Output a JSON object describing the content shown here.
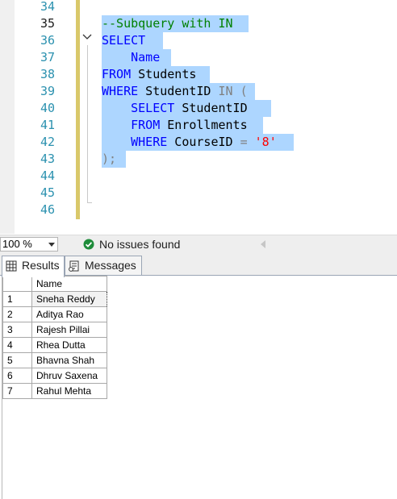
{
  "editor": {
    "line_numbers": [
      "34",
      "35",
      "36",
      "37",
      "38",
      "39",
      "40",
      "41",
      "42",
      "43",
      "44",
      "45",
      "46"
    ],
    "lines": {
      "l35": {
        "comment": "--Subquery with IN"
      },
      "l36": {
        "kw": "SELECT"
      },
      "l37": {
        "ident": "    Name"
      },
      "l38": {
        "kw": "FROM",
        "ident": " Students"
      },
      "l39": {
        "kw": "WHERE",
        "ident": " StudentID ",
        "kw2": "IN",
        "op": " ("
      },
      "l40": {
        "indent": "    ",
        "kw": "SELECT",
        "ident": " StudentID"
      },
      "l41": {
        "indent": "    ",
        "kw": "FROM",
        "ident": " Enrollments"
      },
      "l42": {
        "indent": "    ",
        "kw": "WHERE",
        "ident": " CourseID ",
        "op": "=",
        "space": " ",
        "str": "'8'"
      },
      "l43": {
        "op": ");"
      }
    }
  },
  "status": {
    "zoom": "100 %",
    "issues": "No issues found"
  },
  "tabs": {
    "results": "Results",
    "messages": "Messages"
  },
  "results_grid": {
    "column_header": "Name",
    "rows": [
      {
        "n": "1",
        "name": "Sneha Reddy"
      },
      {
        "n": "2",
        "name": "Aditya Rao"
      },
      {
        "n": "3",
        "name": "Rajesh Pillai"
      },
      {
        "n": "4",
        "name": "Rhea Dutta"
      },
      {
        "n": "5",
        "name": "Bhavna Shah"
      },
      {
        "n": "6",
        "name": "Dhruv Saxena"
      },
      {
        "n": "7",
        "name": "Rahul Mehta"
      }
    ]
  },
  "colors": {
    "keyword": "#0000ff",
    "comment": "#008000",
    "string": "#ff0000",
    "selection": "#add6ff",
    "line_number": "#2b91af"
  }
}
